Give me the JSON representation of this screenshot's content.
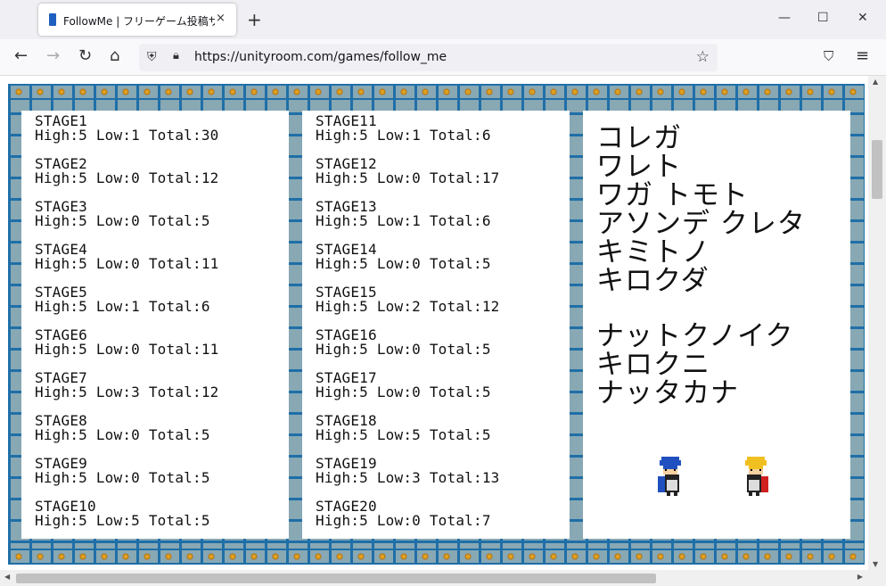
{
  "tab": {
    "title": "FollowMe | フリーゲーム投稿サイト",
    "close": "×"
  },
  "newtab_label": "+",
  "window": {
    "minimize": "—",
    "maximize": "☐",
    "close": "✕"
  },
  "nav": {
    "back": "←",
    "forward": "→",
    "reload": "↻",
    "home": "⌂",
    "url": "https://unityroom.com/games/follow_me",
    "pocket": "⛉",
    "menu": "≡"
  },
  "game": {
    "left_column": [
      {
        "stage": "STAGE1",
        "stats": "High:5 Low:1 Total:30"
      },
      {
        "stage": "STAGE2",
        "stats": "High:5 Low:0 Total:12"
      },
      {
        "stage": "STAGE3",
        "stats": "High:5 Low:0 Total:5"
      },
      {
        "stage": "STAGE4",
        "stats": "High:5 Low:0 Total:11"
      },
      {
        "stage": "STAGE5",
        "stats": "High:5 Low:1 Total:6"
      },
      {
        "stage": "STAGE6",
        "stats": "High:5 Low:0 Total:11"
      },
      {
        "stage": "STAGE7",
        "stats": "High:5 Low:3 Total:12"
      },
      {
        "stage": "STAGE8",
        "stats": "High:5 Low:0 Total:5"
      },
      {
        "stage": "STAGE9",
        "stats": "High:5 Low:0 Total:5"
      },
      {
        "stage": "STAGE10",
        "stats": "High:5 Low:5 Total:5"
      }
    ],
    "middle_column": [
      {
        "stage": "STAGE11",
        "stats": "High:5 Low:1 Total:6"
      },
      {
        "stage": "STAGE12",
        "stats": "High:5 Low:0 Total:17"
      },
      {
        "stage": "STAGE13",
        "stats": "High:5 Low:1 Total:6"
      },
      {
        "stage": "STAGE14",
        "stats": "High:5 Low:0 Total:5"
      },
      {
        "stage": "STAGE15",
        "stats": "High:5 Low:2 Total:12"
      },
      {
        "stage": "STAGE16",
        "stats": "High:5 Low:0 Total:5"
      },
      {
        "stage": "STAGE17",
        "stats": "High:5 Low:0 Total:5"
      },
      {
        "stage": "STAGE18",
        "stats": "High:5 Low:5 Total:5"
      },
      {
        "stage": "STAGE19",
        "stats": "High:5 Low:3 Total:13"
      },
      {
        "stage": "STAGE20",
        "stats": "High:5 Low:0 Total:7"
      }
    ],
    "message_lines": [
      "コレガ",
      "ワレト",
      "ワガ トモト",
      "アソンデ クレタ",
      "キミトノ",
      "キロクダ"
    ],
    "message_lines2": [
      "ナットクノイク",
      "キロクニ",
      "ナッタカナ"
    ],
    "characters": [
      {
        "name": "blue-haired-character",
        "color": "#2050c0"
      },
      {
        "name": "blonde-character",
        "color": "#f0c020"
      }
    ]
  }
}
